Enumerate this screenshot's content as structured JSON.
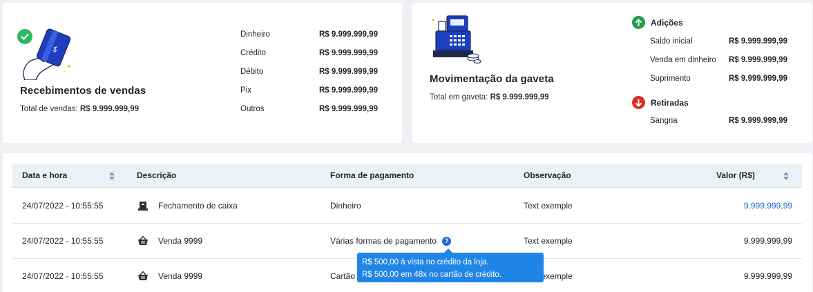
{
  "sales": {
    "title": "Recebimentos de vendas",
    "total_label": "Total de vendas:",
    "total_value": "R$ 9.999.999,99",
    "rows": [
      {
        "label": "Dinheiro",
        "value": "R$ 9.999.999,99"
      },
      {
        "label": "Crédito",
        "value": "R$ 9.999.999,99"
      },
      {
        "label": "Débito",
        "value": "R$ 9.999.999,99"
      },
      {
        "label": "Pix",
        "value": "R$ 9.999.999,99"
      },
      {
        "label": "Outros",
        "value": "R$ 9.999.999,99"
      }
    ]
  },
  "drawer": {
    "title": "Movimentação da gaveta",
    "total_label": "Total em gaveta:",
    "total_value": "R$ 9.999.999,99",
    "additions_title": "Adições",
    "additions": [
      {
        "label": "Saldo inicial",
        "value": "R$ 9.999.999,99"
      },
      {
        "label": "Venda em dinheiro",
        "value": "R$ 9.999.999,99"
      },
      {
        "label": "Suprimento",
        "value": "R$ 9.999.999,99"
      }
    ],
    "withdrawals_title": "Retiradas",
    "withdrawals": [
      {
        "label": "Sangria",
        "value": "R$ 9.999.999,99"
      }
    ]
  },
  "table": {
    "headers": {
      "datetime": "Data e hora",
      "description": "Descrição",
      "payment": "Forma de pagamento",
      "note": "Observação",
      "value": "Valor (R$)"
    },
    "rows": [
      {
        "datetime": "24/07/2022 - 10:55:55",
        "icon": "cash-register-icon",
        "description": "Fechamento de caixa",
        "payment": "Dinheiro",
        "note": "Text exemple",
        "value": "9.999.999,99",
        "value_color": "#1a6bd1"
      },
      {
        "datetime": "24/07/2022 - 10:55:55",
        "icon": "basket-icon",
        "description": "Venda 9999",
        "payment": "Várias formas de pagamento",
        "note": "Text exemple",
        "value": "9.999.999,99",
        "value_color": "#1f2329"
      },
      {
        "datetime": "24/07/2022 - 10:55:55",
        "icon": "basket-icon",
        "description": "Venda 9999",
        "payment": "Cartão",
        "note": "Text exemple",
        "value": "9.999.999,99",
        "value_color": "#1f2329"
      }
    ]
  },
  "tooltip": {
    "lines": [
      "R$ 500,00 à vista no crédito da loja.",
      "R$ 500,00 em 48x no cartão de crédito."
    ]
  },
  "colors": {
    "accent": "#1a6bd1",
    "addition": "#1e9e4a",
    "withdrawal": "#d93025",
    "tooltip": "#1f86e8"
  }
}
